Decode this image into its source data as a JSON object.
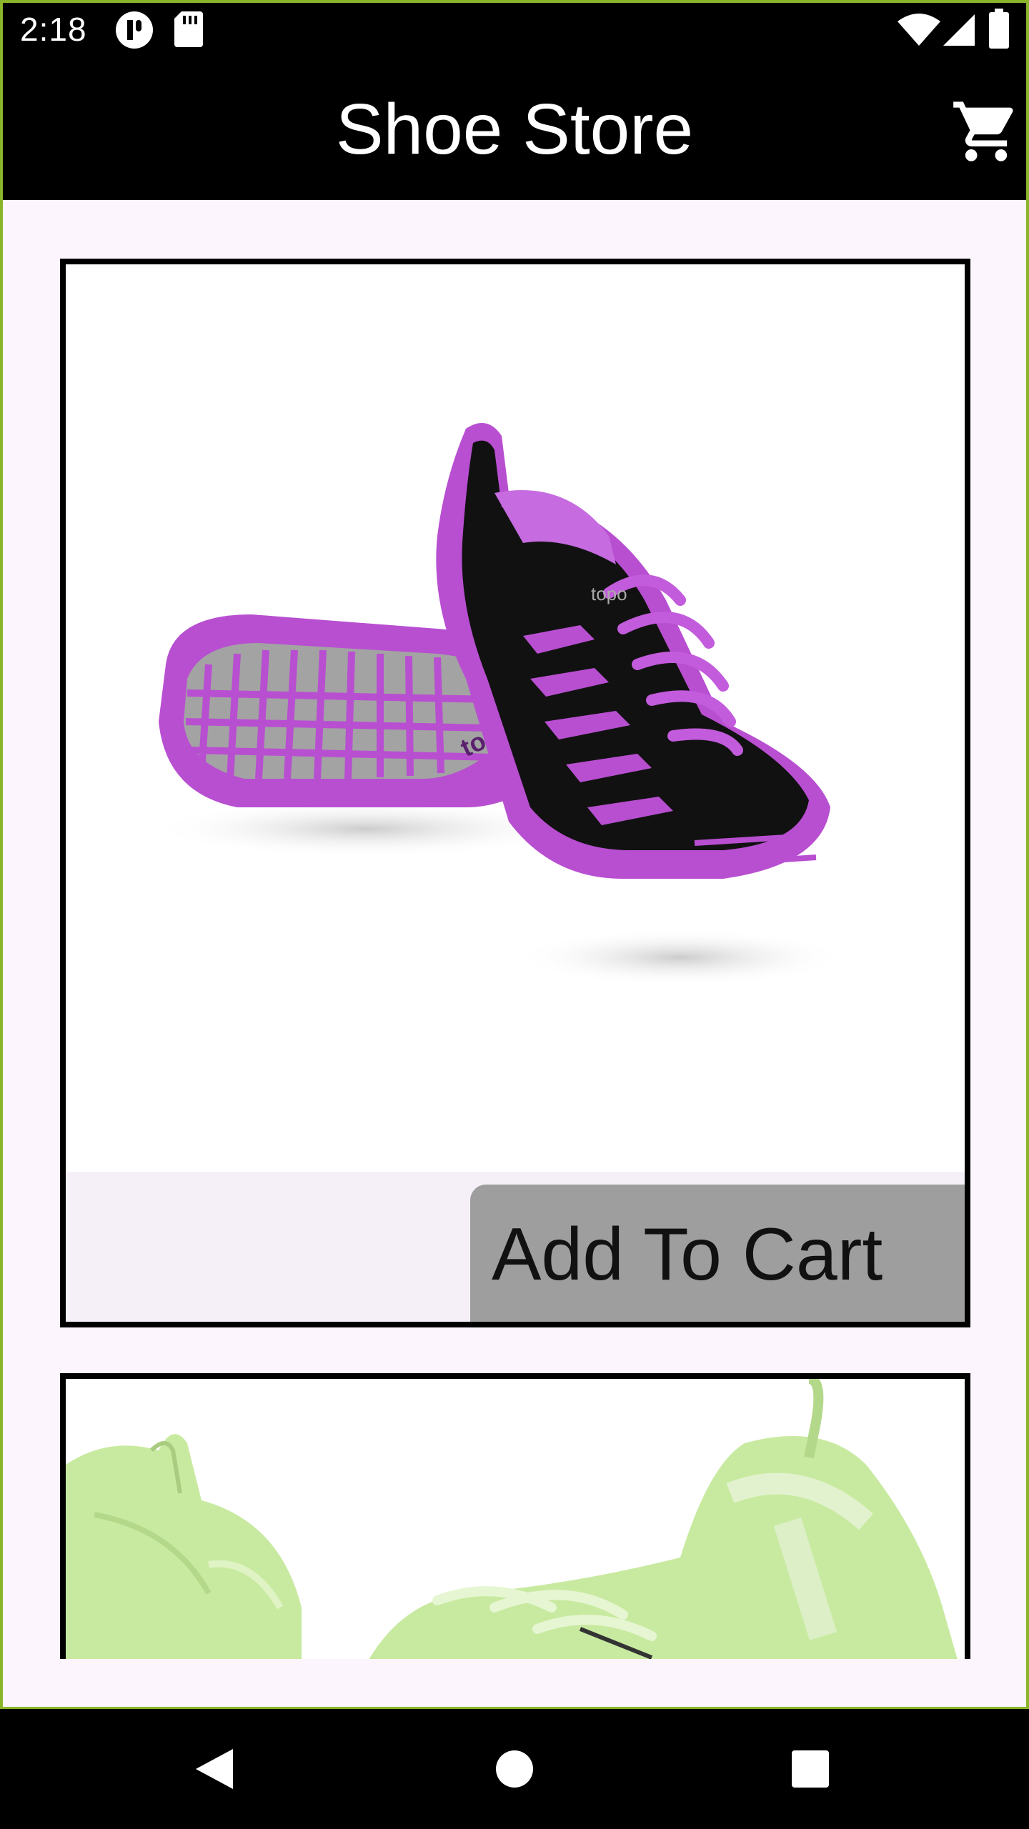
{
  "status_bar": {
    "time": "2:18",
    "icons": [
      "signal-app-icon",
      "sd-card-icon",
      "wifi-icon",
      "cell-signal-icon",
      "battery-icon"
    ]
  },
  "app_bar": {
    "title": "Shoe Store",
    "cart_icon": "shopping-cart-icon"
  },
  "products": [
    {
      "image": "purple-black-running-shoe",
      "brand_text": "topo",
      "button_label": "Add To Cart"
    },
    {
      "image": "light-green-sneaker"
    }
  ],
  "nav_bar": {
    "buttons": [
      "back-icon",
      "home-icon",
      "recents-icon"
    ]
  },
  "colors": {
    "bar_background": "#000000",
    "content_background": "#fcf5fd",
    "card_border": "#000000",
    "button_background": "#9e9e9e",
    "frame_accent": "#8ab42a",
    "shoe_purple": "#b84fd1",
    "shoe_green": "#c8eaa0"
  }
}
